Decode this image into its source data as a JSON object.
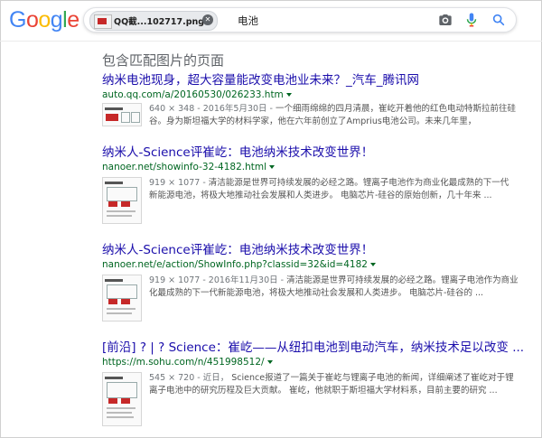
{
  "logo": {
    "text": "Google"
  },
  "search": {
    "image_chip_label": "QQ截...102717.png",
    "query": "电池"
  },
  "icons": {
    "camera": "camera-icon",
    "mic": "microphone-icon",
    "search": "search-icon",
    "clear": "close-icon"
  },
  "section_title": "包含匹配图片的页面",
  "results": [
    {
      "title": "纳米电池现身，超大容量能改变电池业未来？_汽车_腾讯网",
      "url": "auto.qq.com/a/20160530/026233.htm",
      "meta": "640 × 348 - 2016年5月30日 -",
      "snippet_line1": "一个细雨绵绵的四月清晨，崔屹开着他的红色电动特斯拉前往硅",
      "snippet_line2": "谷。身为斯坦福大学的材料学家，他在六年前创立了Amprius电池公司。未来几年里，"
    },
    {
      "title": "纳米人-Science评崔屹：电池纳米技术改变世界！",
      "url": "nanoer.net/showinfo-32-4182.html",
      "meta": "919 × 1077 -",
      "snippet_line1": "清洁能源是世界可持续发展的必经之路。锂离子电池作为商业化最成熟的下一代",
      "snippet_line2": "新能源电池，将极大地推动社会发展和人类进步。 电脑芯片-硅谷的原始创新，几十年来 ..."
    },
    {
      "title": "纳米人-Science评崔屹：电池纳米技术改变世界！",
      "url": "nanoer.net/e/action/ShowInfo.php?classid=32&id=4182",
      "meta": "919 × 1077 - 2016年11月30日 -",
      "snippet_line1": "清洁能源是世界可持续发展的必经之路。锂离子电池作为商业",
      "snippet_line2": "化最成熟的下一代新能源电池，将极大地推动社会发展和人类进步。 电脑芯片-硅谷的 ..."
    },
    {
      "title": "[前沿] ? | ? Science：崔屹——从纽扣电池到电动汽车，纳米技术足以改变 ...",
      "url": "https://m.sohu.com/n/451998512/",
      "meta": "545 × 720 - 近日，",
      "snippet_line1": "Science报道了一篇关于崔屹与锂离子电池的新闻，详细阐述了崔屹对于锂",
      "snippet_line2": "离子电池中的研究历程及巨大贡献。 崔屹，他就职于斯坦福大学材料系，目前主要的研究 ..."
    }
  ],
  "colors": {
    "link": "#1a0dab",
    "url": "#006621",
    "snippet": "#545454",
    "google_blue": "#4285F4",
    "google_red": "#EA4335",
    "google_yellow": "#FBBC05",
    "google_green": "#34A853"
  }
}
